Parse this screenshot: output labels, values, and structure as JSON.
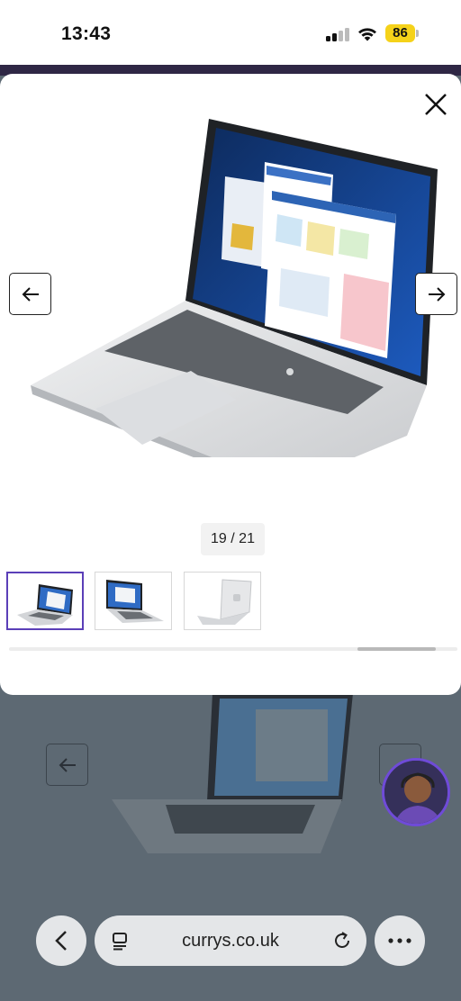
{
  "status_bar": {
    "time": "13:43",
    "battery": "86"
  },
  "gallery": {
    "counter": "19 / 21",
    "thumbnails": [
      {
        "name": "laptop-front-angle"
      },
      {
        "name": "laptop-front"
      },
      {
        "name": "laptop-lid-closed-back"
      }
    ]
  },
  "browser": {
    "url": "currys.co.uk"
  },
  "colors": {
    "accent": "#5b3fb8",
    "brand_band": "#2f2745",
    "overlay": "#5d6973"
  }
}
